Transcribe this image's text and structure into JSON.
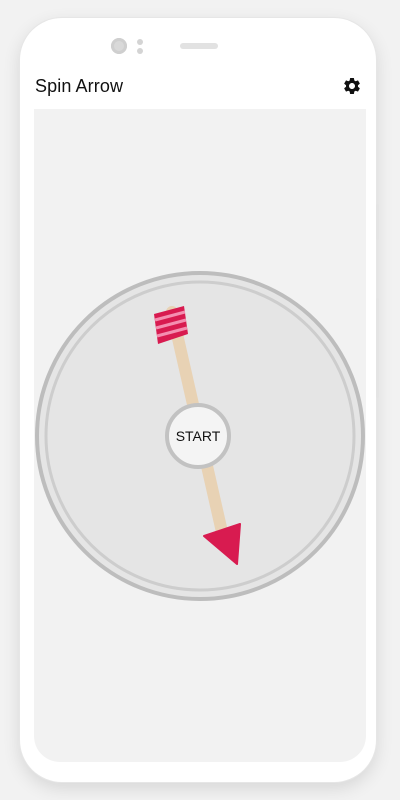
{
  "app": {
    "title": "Spin Arrow"
  },
  "toolbar": {
    "settings_icon": "gear-icon"
  },
  "spinner": {
    "start_label": "START"
  },
  "colors": {
    "arrow_head": "#d81b50",
    "arrow_shaft": "#e8d2b4",
    "fletching_light": "#f48fb1",
    "dial_fill": "#e5e5e5",
    "dial_ring": "#bdbdbd"
  }
}
